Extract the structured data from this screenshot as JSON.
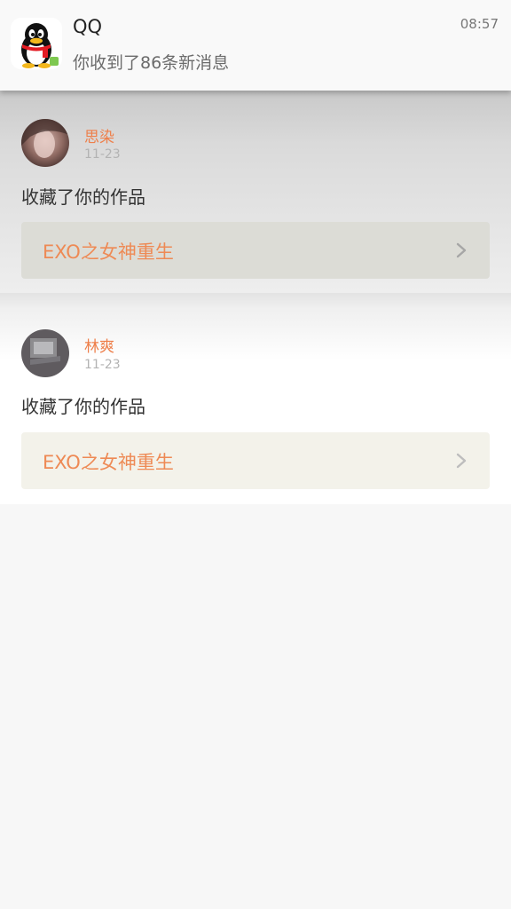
{
  "notification": {
    "app_name": "QQ",
    "message": "你收到了86条新消息",
    "time": "08:57",
    "icon": "qq-penguin-icon"
  },
  "feed": {
    "items": [
      {
        "user_name": "思染",
        "date": "11-23",
        "action": "收藏了你的作品",
        "work_title": "EXO之女神重生"
      },
      {
        "user_name": "林爽",
        "date": "11-23",
        "action": "收藏了你的作品",
        "work_title": "EXO之女神重生"
      }
    ]
  },
  "colors": {
    "accent": "#ee7f4a",
    "date": "#b3b3b3",
    "background": "#f7f7f7"
  }
}
